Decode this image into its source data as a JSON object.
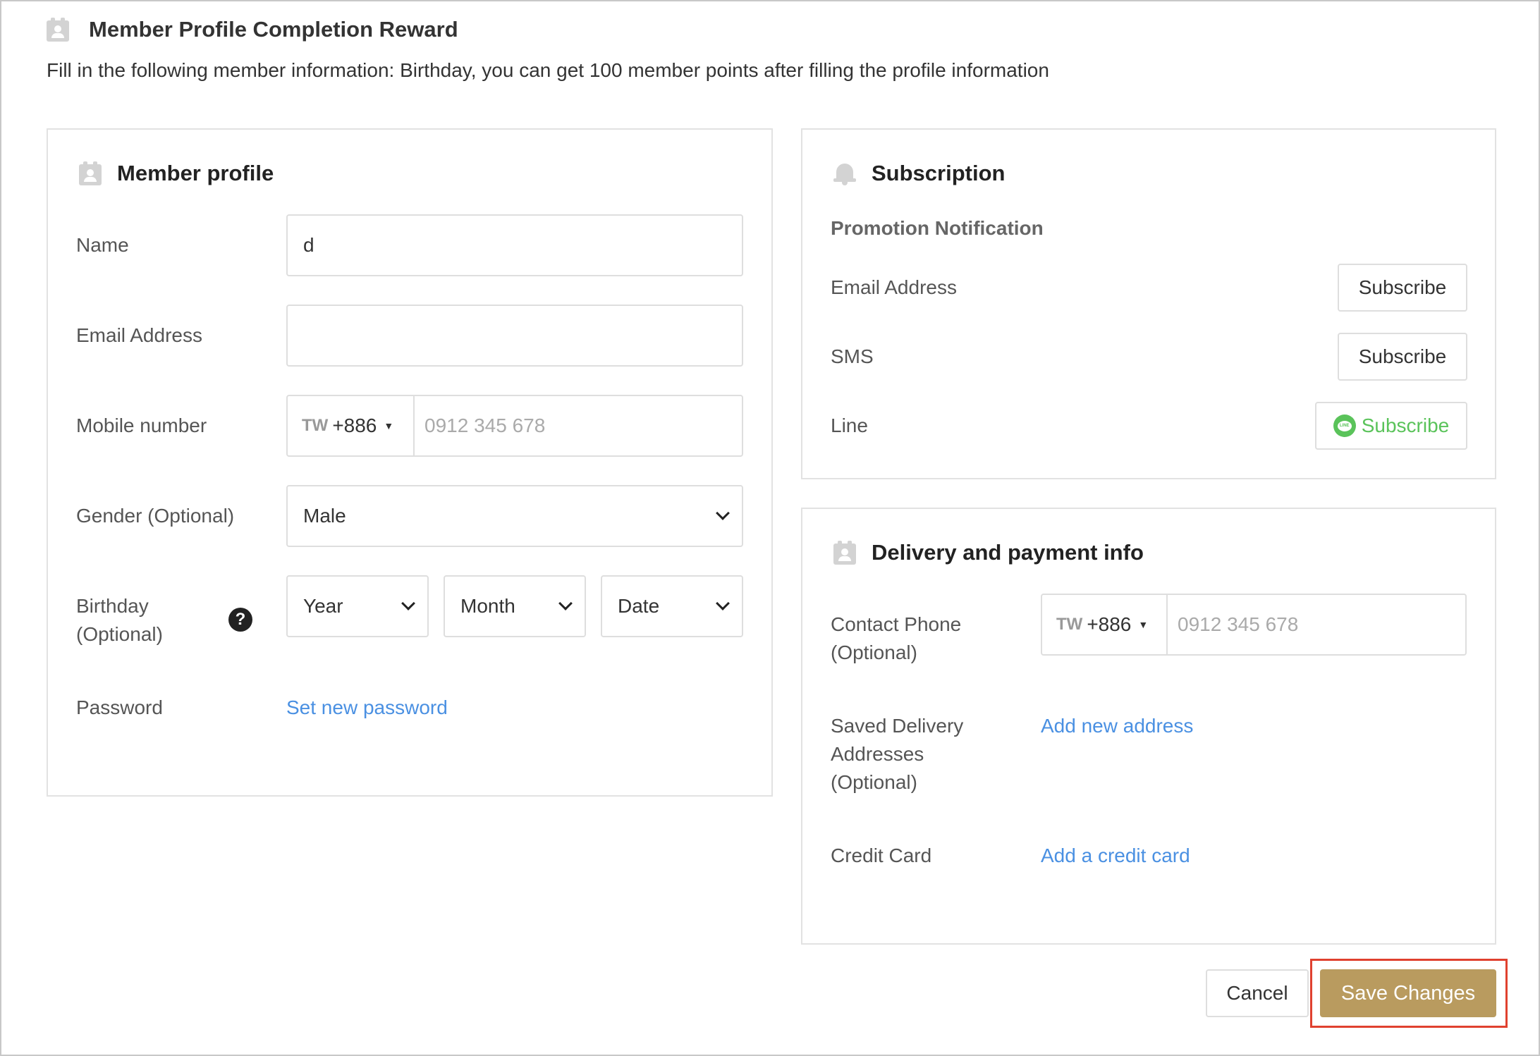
{
  "reward": {
    "title": "Member Profile Completion Reward",
    "description": "Fill in the following member information: Birthday, you can get 100 member points after filling the profile information"
  },
  "member_profile": {
    "title": "Member profile",
    "name_label": "Name",
    "name_value": "d",
    "email_label": "Email Address",
    "email_value": "",
    "mobile_label": "Mobile number",
    "mobile_country": "TW",
    "mobile_code": "+886",
    "mobile_placeholder": "0912 345 678",
    "gender_label": "Gender (Optional)",
    "gender_value": "Male",
    "birthday_label_line1": "Birthday",
    "birthday_label_line2": "(Optional)",
    "birthday_year": "Year",
    "birthday_month": "Month",
    "birthday_date": "Date",
    "password_label": "Password",
    "password_link": "Set new password"
  },
  "subscription": {
    "title": "Subscription",
    "subheading": "Promotion Notification",
    "email_label": "Email Address",
    "email_button": "Subscribe",
    "sms_label": "SMS",
    "sms_button": "Subscribe",
    "line_label": "Line",
    "line_button": "Subscribe",
    "line_brand": "LINE"
  },
  "delivery": {
    "title": "Delivery and payment info",
    "phone_label_line1": "Contact Phone",
    "phone_label_line2": "(Optional)",
    "phone_country": "TW",
    "phone_code": "+886",
    "phone_placeholder": "0912 345 678",
    "address_label_line1": "Saved Delivery",
    "address_label_line2": "Addresses",
    "address_label_line3": "(Optional)",
    "address_link": "Add new address",
    "card_label": "Credit Card",
    "card_link": "Add a credit card"
  },
  "actions": {
    "cancel": "Cancel",
    "save": "Save Changes"
  },
  "colors": {
    "accent": "#b99b5f",
    "link": "#4a90e2",
    "line_green": "#5ac35a",
    "highlight": "#e0412f"
  },
  "icons": [
    "member-badge-icon",
    "bell-icon",
    "help-icon",
    "chevron-down-icon",
    "line-icon"
  ]
}
